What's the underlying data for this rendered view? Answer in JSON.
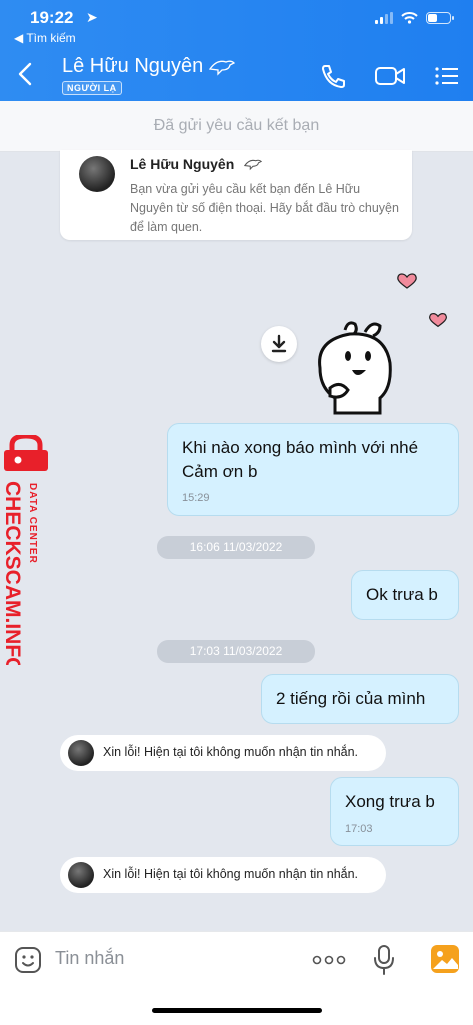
{
  "status_bar": {
    "time": "19:22",
    "back_app": "◀ Tìm kiếm"
  },
  "header": {
    "name": "Lê Hữu Nguyên",
    "badge": "NGƯỜI LẠ"
  },
  "friend_request": "Đã gửi yêu cầu kết bạn",
  "info_card": {
    "name": "Lê Hữu Nguyên",
    "text": "Bạn vừa gửi yêu cầu kết bạn đến Lê Hữu Nguyên từ số điện thoại. Hãy bắt đầu trò chuyện để làm quen."
  },
  "messages": {
    "m1_text": "Khi nào xong báo mình với nhé\nCảm ơn b",
    "m1_time": "15:29",
    "date1": "16:06 11/03/2022",
    "m2_text": "Ok trưa b",
    "date2": "17:03 11/03/2022",
    "m3_text": "2 tiếng rồi của mình",
    "sys1": "Xin lỗi! Hiện tại tôi không muốn nhận tin nhắn.",
    "m4_text": "Xong trưa b",
    "m4_time": "17:03",
    "sys2": "Xin lỗi! Hiện tại tôi không muốn nhận tin nhắn."
  },
  "watermark": {
    "brand": "CHECKSCAM.INFO",
    "sub": "DATA CENTER"
  },
  "input": {
    "placeholder": "Tin nhắn"
  },
  "colors": {
    "header": "#2f8cf2",
    "bubble": "#d5f1ff",
    "watermark": "#e8202a"
  }
}
